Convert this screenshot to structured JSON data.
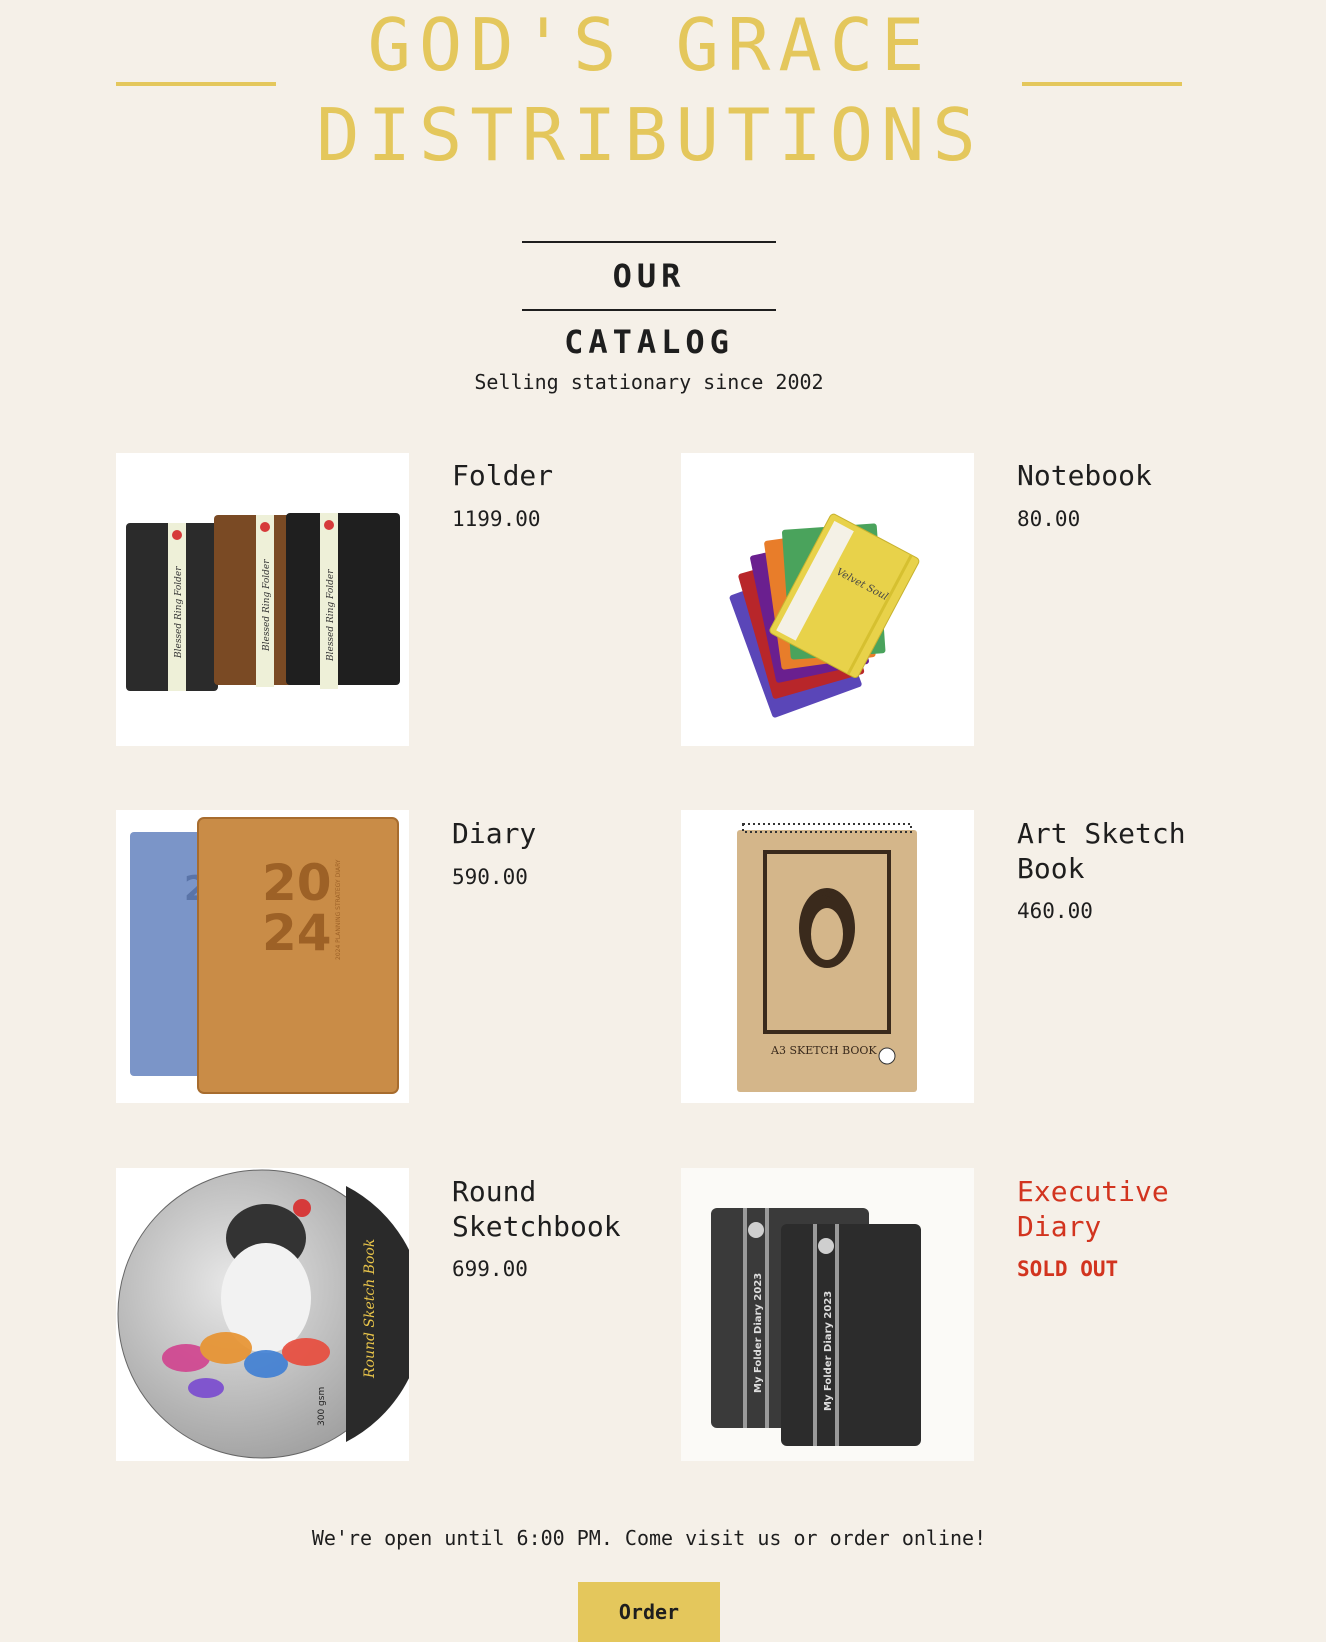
{
  "brand": {
    "line1": "GOD'S GRACE",
    "line2": "DISTRIBUTIONS",
    "color": "#e4c75c"
  },
  "catalog": {
    "title": "OUR CATALOG",
    "tagline": "Selling stationary since 2002"
  },
  "products": [
    {
      "name": "Folder",
      "price": "1199.00",
      "image": "leather-ring-folders"
    },
    {
      "name": "Notebook",
      "price": "80.00",
      "image": "colorful-notebooks"
    },
    {
      "name": "Diary",
      "price": "590.00",
      "image": "2024-diaries"
    },
    {
      "name": "Art Sketch Book",
      "price": "460.00",
      "image": "a3-sketch-book"
    },
    {
      "name": "Round Sketchbook",
      "price": "699.00",
      "image": "round-sketch-book"
    },
    {
      "name": "Executive Diary",
      "price": "SOLD OUT",
      "image": "executive-diaries",
      "sold_out": true
    }
  ],
  "images": {
    "folder_spine_text": "Blessed Ring Folder",
    "notebook_cover_text": "Velvet Soul",
    "diary_year_top": "20",
    "diary_year_bottom": "24",
    "diary_side_text": "2024 PLANNING STRATEGY DIARY",
    "sketch_book_label": "A3 SKETCH BOOK",
    "round_spine_text": "Round Sketch Book",
    "round_gsm": "300 gsm",
    "exec_spine_text": "My Folder Diary 2023"
  },
  "colors": {
    "sold_out": "#d2341f",
    "background": "#f5f0e8",
    "text": "#1e1e1e"
  },
  "footer": {
    "text": "We're open until 6:00 PM. Come visit us or order online!",
    "order_label": "Order"
  }
}
